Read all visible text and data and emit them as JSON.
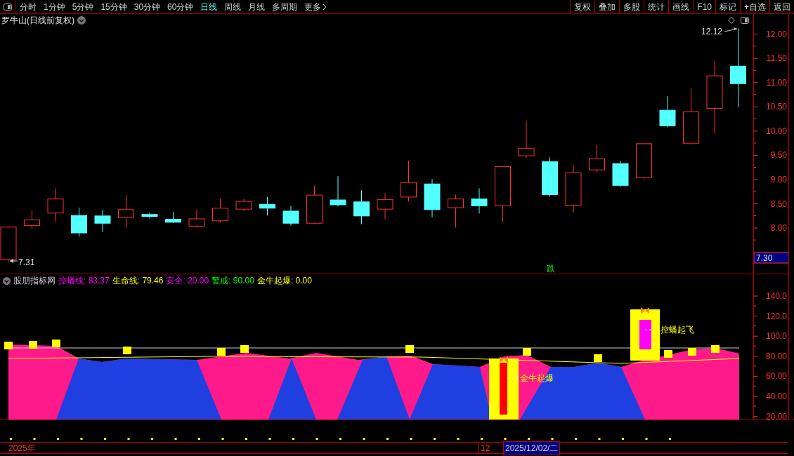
{
  "toolbar": {
    "periods": [
      {
        "label": "分时",
        "selected": false
      },
      {
        "label": "1分钟",
        "selected": false
      },
      {
        "label": "5分钟",
        "selected": false
      },
      {
        "label": "15分钟",
        "selected": false
      },
      {
        "label": "30分钟",
        "selected": false
      },
      {
        "label": "60分钟",
        "selected": false
      },
      {
        "label": "日线",
        "selected": true
      },
      {
        "label": "周线",
        "selected": false
      },
      {
        "label": "月线",
        "selected": false
      },
      {
        "label": "多周期",
        "selected": false
      },
      {
        "label": "更多",
        "selected": false
      }
    ],
    "buttons": [
      "复权",
      "叠加",
      "多股",
      "统计",
      "画线",
      "F10",
      "标记",
      "+自选",
      "返回"
    ]
  },
  "chart": {
    "title": "罗牛山(日线前复权)",
    "high_label": "12.12",
    "low_label": "7.31",
    "signal": "跌",
    "price_tag": "7.30",
    "axis_labels": [
      "12.00",
      "11.50",
      "11.00",
      "10.50",
      "10.00",
      "9.50",
      "9.00",
      "8.50",
      "8.00"
    ]
  },
  "indicator": {
    "name": "股朋指标网",
    "values": [
      {
        "label": "控蟠线:",
        "value": "83.37",
        "color": "#ff00ff"
      },
      {
        "label": "生命线:",
        "value": "79.46",
        "color": "#ffff00"
      },
      {
        "label": "安全:",
        "value": "20.00",
        "color": "#ff00ff"
      },
      {
        "label": "警戒:",
        "value": "90.00",
        "color": "#00ff00"
      },
      {
        "label": "金牛起爆:",
        "value": "0.00",
        "color": "#ffff00"
      }
    ],
    "signals": [
      "金牛起爆",
      "控蟠起飞"
    ],
    "axis_labels": [
      "140.0",
      "120.0",
      "100.0",
      "80.00",
      "60.00",
      "40.00",
      "20.00"
    ]
  },
  "timeline": {
    "year": "2025年",
    "month": "12",
    "cursor_date": "2025/12/02/二"
  }
}
